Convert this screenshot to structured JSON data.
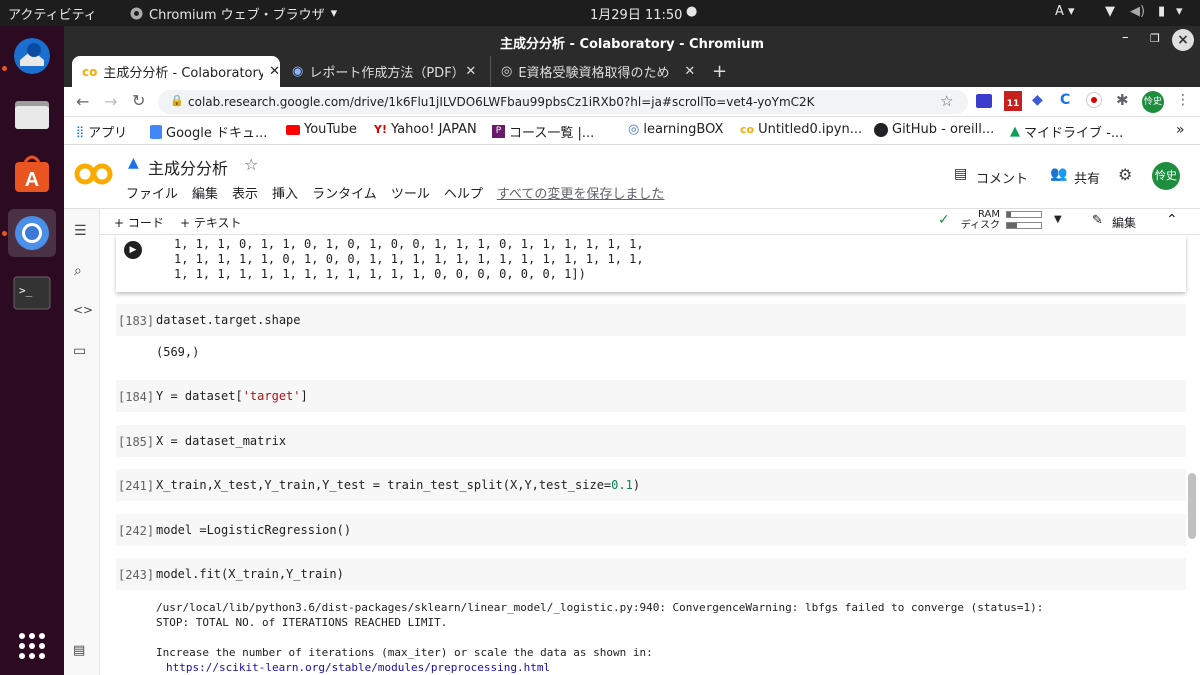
{
  "system": {
    "activities": "アクティビティ",
    "app_name": "Chromium ウェブ・ブラウザ",
    "clock": "1月29日  11:50",
    "ime": "A"
  },
  "window": {
    "title": "主成分分析 - Colaboratory - Chromium"
  },
  "tabs": [
    {
      "label": "主成分分析 - Colaboratory"
    },
    {
      "label": "レポート作成方法（PDF）"
    },
    {
      "label": "E資格受験資格取得のため"
    }
  ],
  "toolbar": {
    "url": "colab.research.google.com/drive/1k6Flu1jILVDO6LWFbau99pbsCz1iRXb0?hl=ja#scrollTo=vet4-yoYmC2K"
  },
  "bookmarks": [
    {
      "label": "アプリ",
      "icon": "apps-grid-icon"
    },
    {
      "label": "Google ドキュ...",
      "icon": "google-docs-icon"
    },
    {
      "label": "YouTube",
      "icon": "youtube-icon"
    },
    {
      "label": "Yahoo! JAPAN",
      "icon": "yahoo-icon"
    },
    {
      "label": "コース一覧 |...",
      "icon": "course-icon"
    },
    {
      "label": "learningBOX",
      "icon": "learningbox-icon"
    },
    {
      "label": "Untitled0.ipyn...",
      "icon": "colab-icon"
    },
    {
      "label": "GitHub - oreill...",
      "icon": "github-icon"
    },
    {
      "label": "マイドライブ -...",
      "icon": "drive-icon"
    }
  ],
  "colab": {
    "notebook_title": "主成分分析",
    "menu": [
      "ファイル",
      "編集",
      "表示",
      "挿入",
      "ランタイム",
      "ツール",
      "ヘルプ"
    ],
    "save_status": "すべての変更を保存しました",
    "comment_label": "コメント",
    "share_label": "共有",
    "avatar": "怜史",
    "add_code": "+ コード",
    "add_text": "+ テキスト",
    "ram_label": "RAM",
    "disk_label": "ディスク",
    "edit_label": "編集"
  },
  "cells": {
    "top_output": [
      "1, 1, 1, 0, 1, 1, 0, 1, 0, 1, 0, 0, 1, 1, 1, 0, 1, 1, 1, 1, 1, 1,",
      "1, 1, 1, 1, 1, 0, 1, 0, 0, 1, 1, 1, 1, 1, 1, 1, 1, 1, 1, 1, 1, 1,",
      "1, 1, 1, 1, 1, 1, 1, 1, 1, 1, 1, 1, 0, 0, 0, 0, 0, 0, 1])"
    ],
    "c183": {
      "num": "[183]",
      "code": "dataset.target.shape",
      "output": "(569,)"
    },
    "c184": {
      "num": "[184]",
      "code_a": "Y = dataset[",
      "code_str": "'target'",
      "code_b": "]"
    },
    "c185": {
      "num": "[185]",
      "code": "X = dataset_matrix"
    },
    "c241": {
      "num": "[241]",
      "code_a": "X_train,X_test,Y_train,Y_test = train_test_split(X,Y,test_size=",
      "code_num": "0.1",
      "code_b": ")"
    },
    "c242": {
      "num": "[242]",
      "code": "model =LogisticRegression()"
    },
    "c243": {
      "num": "[243]",
      "code": "model.fit(X_train,Y_train)",
      "out1": "/usr/local/lib/python3.6/dist-packages/sklearn/linear_model/_logistic.py:940: ConvergenceWarning: lbfgs failed to converge (status=1):",
      "out2": "STOP: TOTAL NO. of ITERATIONS REACHED LIMIT.",
      "out3": "Increase the number of iterations (max_iter) or scale the data as shown in:",
      "link": "https://scikit-learn.org/stable/modules/preprocessing.html"
    }
  },
  "colors": {
    "colab_orange": "#f9ab00",
    "ubuntu_dock": "#2c0b22",
    "avatar_green": "#1e8e3e"
  }
}
